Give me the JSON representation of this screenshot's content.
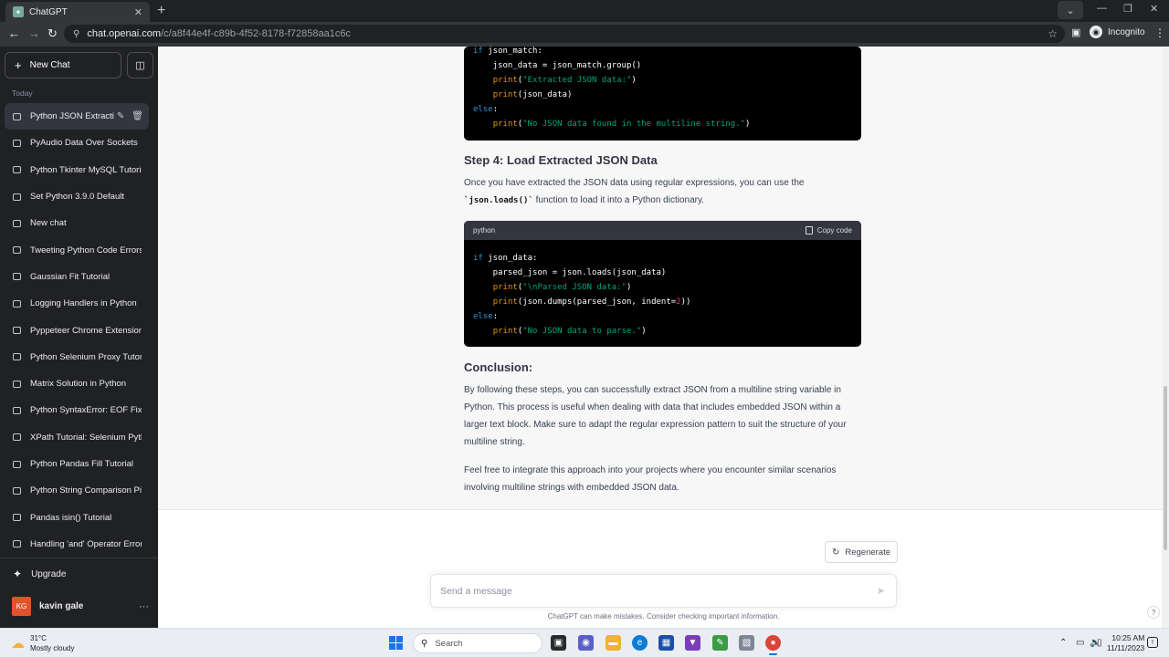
{
  "browser": {
    "tab_title": "ChatGPT",
    "url_host": "chat.openai.com",
    "url_path": "/c/a8f44e4f-c89b-4f52-8178-f72858aa1c6c",
    "incognito_label": "Incognito"
  },
  "sidebar": {
    "new_chat_label": "New Chat",
    "section_label": "Today",
    "items": [
      {
        "label": "Python JSON Extraction"
      },
      {
        "label": "PyAudio Data Over Sockets"
      },
      {
        "label": "Python Tkinter MySQL Tutorial"
      },
      {
        "label": "Set Python 3.9.0 Default"
      },
      {
        "label": "New chat"
      },
      {
        "label": "Tweeting Python Code Errors"
      },
      {
        "label": "Gaussian Fit Tutorial"
      },
      {
        "label": "Logging Handlers in Python"
      },
      {
        "label": "Pyppeteer Chrome Extension"
      },
      {
        "label": "Python Selenium Proxy Tutorial"
      },
      {
        "label": "Matrix Solution in Python"
      },
      {
        "label": "Python SyntaxError: EOF Fix"
      },
      {
        "label": "XPath Tutorial: Selenium Python"
      },
      {
        "label": "Python Pandas Fill Tutorial"
      },
      {
        "label": "Python String Comparison Pitfalls"
      },
      {
        "label": "Pandas isin() Tutorial"
      },
      {
        "label": "Handling 'and' Operator Errors"
      }
    ],
    "upgrade_label": "Upgrade",
    "user": {
      "initials": "KG",
      "name": "kavin gale"
    }
  },
  "conversation": {
    "code_block_1": {
      "lines": [
        "if json_match:",
        "    json_data = json_match.group()",
        "    print(\"Extracted JSON data:\")",
        "    print(json_data)",
        "else:",
        "    print(\"No JSON data found in the multiline string.\")"
      ]
    },
    "step4_heading": "Step 4: Load Extracted JSON Data",
    "step4_para_before": "Once you have extracted the JSON data using regular expressions, you can use the",
    "step4_inline_code": "`json.loads()`",
    "step4_para_after": "function to load it into a Python dictionary.",
    "code_block_2": {
      "language": "python",
      "copy_label": "Copy code",
      "lines": [
        "if json_data:",
        "    parsed_json = json.loads(json_data)",
        "    print(\"\\nParsed JSON data:\")",
        "    print(json.dumps(parsed_json, indent=2))",
        "else:",
        "    print(\"No JSON data to parse.\")"
      ]
    },
    "conclusion_heading": "Conclusion:",
    "conclusion_para": "By following these steps, you can successfully extract JSON from a multiline string variable in Python. This process is useful when dealing with data that includes embedded JSON within a larger text block. Make sure to adapt the regular expression pattern to suit the structure of your multiline string.",
    "closing_para": "Feel free to integrate this approach into your projects where you encounter similar scenarios involving multiline strings with embedded JSON data."
  },
  "composer": {
    "regenerate_label": "Regenerate",
    "placeholder": "Send a message",
    "disclaimer": "ChatGPT can make mistakes. Consider checking important information.",
    "help_label": "?"
  },
  "taskbar": {
    "weather_temp": "31°C",
    "weather_desc": "Mostly cloudy",
    "search_label": "Search",
    "time": "10:25 AM",
    "date": "11/11/2023"
  },
  "colors": {
    "sidebar_bg": "#202123",
    "assistant_bg": "#f7f7f8",
    "code_bg": "#000000",
    "keyword": "#2e95d3",
    "function": "#e9950c",
    "string": "#00a67d",
    "number": "#df3079"
  }
}
